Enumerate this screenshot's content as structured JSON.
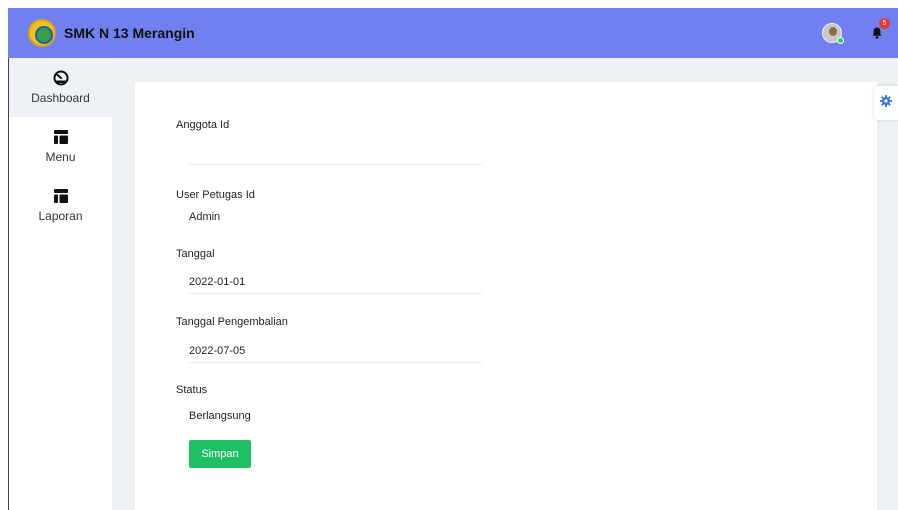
{
  "header": {
    "title": "SMK N 13 Merangin",
    "notification_count": "5",
    "brand_color": "#7180f0"
  },
  "sidebar": {
    "items": [
      {
        "label": "Dashboard",
        "icon": "dashboard-gauge-icon",
        "active": true
      },
      {
        "label": "Menu",
        "icon": "table-icon",
        "active": false
      },
      {
        "label": "Laporan",
        "icon": "table-icon",
        "active": false
      }
    ]
  },
  "form": {
    "fields": [
      {
        "label": "Anggota Id",
        "value": ""
      },
      {
        "label": "User Petugas Id",
        "value": "Admin"
      },
      {
        "label": "Tanggal",
        "value": "2022-01-01"
      },
      {
        "label": "Tanggal Pengembalian",
        "value": "2022-07-05"
      },
      {
        "label": "Status",
        "value": "Berlangsung"
      }
    ],
    "save_label": "Simpan",
    "save_color": "#1fbf63"
  },
  "settings": {
    "icon": "gear-icon"
  }
}
